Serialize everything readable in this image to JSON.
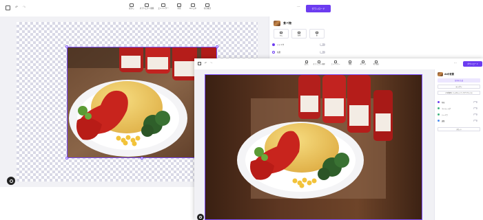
{
  "window1": {
    "toolbar": [
      {
        "label": "ぼかし"
      },
      {
        "label": "オブジェクト削除"
      },
      {
        "label": "エンハンサー"
      },
      {
        "label": "背景"
      },
      {
        "label": "AIジェネ"
      },
      {
        "label": "切り抜き"
      }
    ],
    "download_label": "ダウンロード",
    "sidebar": {
      "title": "食べ物",
      "tiles": [
        {
          "label": "元に"
        },
        {
          "label": "背景"
        },
        {
          "label": "影"
        }
      ],
      "rows": [
        {
          "label": "シャドウ"
        },
        {
          "label": "効果"
        }
      ]
    }
  },
  "window2": {
    "download_label": "ダウンロード",
    "sidebar": {
      "title": "AIの背景",
      "primary_label": "背景を生成",
      "secondary_label": "テンプレ",
      "tertiary_label": "この背景をインスタントバックグラウンドに",
      "rows": [
        {
          "label": "背景"
        },
        {
          "label": "ライティング"
        },
        {
          "label": "シャドウ"
        },
        {
          "label": "調整"
        }
      ],
      "reset_label": "リセット"
    }
  },
  "colors": {
    "accent": "#6c3cf0",
    "selection": "#7c4dff"
  }
}
